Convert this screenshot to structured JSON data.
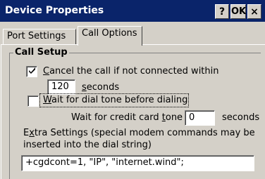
{
  "window": {
    "title": "Device Properties",
    "help_label": "?",
    "ok_label": "OK",
    "close_label": "×"
  },
  "tabs": [
    {
      "label": "Port Settings",
      "active": false
    },
    {
      "label": "Call Options",
      "active": true
    }
  ],
  "call_setup": {
    "group_label": "Call Setup",
    "cancel_call": {
      "checked": true,
      "label_accel": "C",
      "label_rest": "ancel the call if not connected within"
    },
    "timeout_value": "120",
    "timeout_units_accel": "s",
    "timeout_units_rest": "econds",
    "wait_dial_tone": {
      "checked": false,
      "label_accel": "W",
      "label_rest": "ait for dial tone before dialing"
    },
    "credit_card": {
      "label_main": "Wait for credit card ",
      "label_accel": "t",
      "label_rest": "one",
      "value": "0",
      "units": "seconds"
    },
    "extra": {
      "label_pre": "E",
      "label_accel": "x",
      "label_rest": "tra Settings (special modem commands may be",
      "label_line2": "inserted into the dial string)",
      "value": "+cgdcont=1, \"IP\", \"internet.wind\";"
    }
  },
  "colors": {
    "titlebar": "#0a246a",
    "face": "#d4d0c8"
  }
}
